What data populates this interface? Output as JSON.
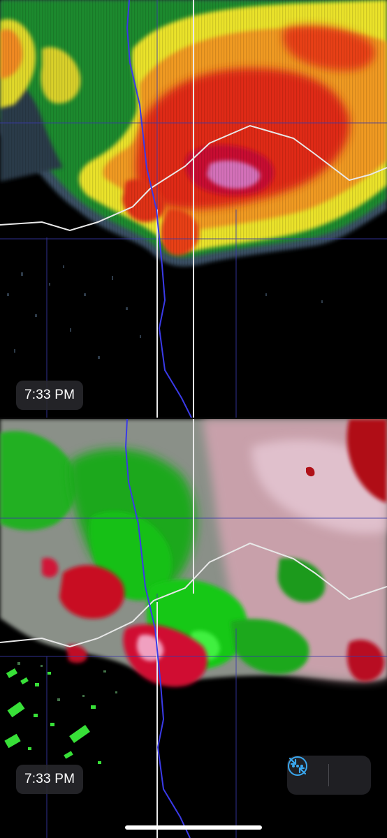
{
  "panels": {
    "reflectivity": {
      "timestamp": "7:33 PM"
    },
    "velocity": {
      "timestamp": "7:33 PM"
    }
  },
  "controls": {
    "more_icon": "ellipsis-circle-icon",
    "collapse_icon": "arrows-collapse-icon",
    "accent_color": "#3aa8f0"
  },
  "colors": {
    "reflectivity_scale": [
      "#2b3542",
      "#3e5a6e",
      "#1e7a2a",
      "#2ea83a",
      "#e8e02a",
      "#f0a020",
      "#e83018",
      "#c81020",
      "#d070b0"
    ],
    "velocity_inbound": "#14c814",
    "velocity_outbound": "#d01030",
    "interstate": "#4040e0",
    "highway": "#e8e8e8"
  }
}
